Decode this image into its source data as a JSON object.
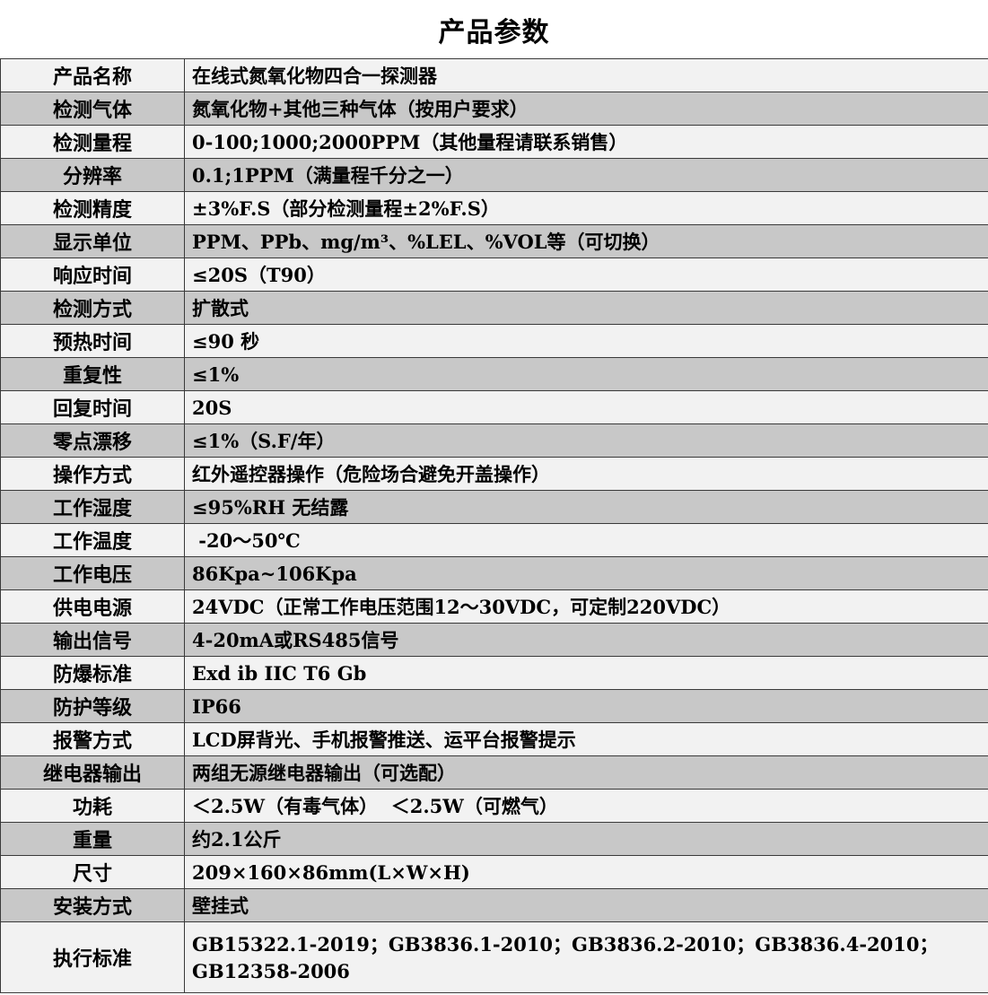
{
  "title": "产品参数",
  "rows": [
    {
      "label": "产品名称",
      "value": "在线式氮氧化物四合一探测器"
    },
    {
      "label": "检测气体",
      "value": "氮氧化物+其他三种气体（按用户要求）"
    },
    {
      "label": "检测量程",
      "value": "0-100;1000;2000PPM（其他量程请联系销售）"
    },
    {
      "label": "分辨率",
      "value": "0.1;1PPM（满量程千分之一）"
    },
    {
      "label": "检测精度",
      "value": "±3%F.S（部分检测量程±2%F.S）"
    },
    {
      "label": "显示单位",
      "value": "PPM、PPb、mg/m³、%LEL、%VOL等（可切换）"
    },
    {
      "label": "响应时间",
      "value": "≤20S（T90）"
    },
    {
      "label": "检测方式",
      "value": "扩散式"
    },
    {
      "label": "预热时间",
      "value": "≤90 秒"
    },
    {
      "label": "重复性",
      "value": "≤1%"
    },
    {
      "label": "回复时间",
      "value": "20S"
    },
    {
      "label": "零点漂移",
      "value": "≤1%（S.F/年）"
    },
    {
      "label": "操作方式",
      "value": "红外遥控器操作（危险场合避免开盖操作）"
    },
    {
      "label": "工作湿度",
      "value": "≤95%RH 无结露"
    },
    {
      "label": "工作温度",
      "value": " -20～50℃"
    },
    {
      "label": "工作电压",
      "value": "86Kpa~106Kpa"
    },
    {
      "label": "供电电源",
      "value": "24VDC（正常工作电压范围12～30VDC，可定制220VDC）"
    },
    {
      "label": "输出信号",
      "value": "4-20mA或RS485信号"
    },
    {
      "label": "防爆标准",
      "value": "Exd ib IIC T6 Gb"
    },
    {
      "label": "防护等级",
      "value": "IP66"
    },
    {
      "label": "报警方式",
      "value": "LCD屏背光、手机报警推送、运平台报警提示"
    },
    {
      "label": "继电器输出",
      "value": "两组无源继电器输出（可选配）"
    },
    {
      "label": "功耗",
      "value": "＜2.5W（有毒气体）  ＜2.5W（可燃气）"
    },
    {
      "label": "重量",
      "value": "约2.1公斤"
    },
    {
      "label": "尺寸",
      "value": "209×160×86mm(L×W×H)"
    },
    {
      "label": "安装方式",
      "value": "壁挂式"
    },
    {
      "label": "执行标准",
      "value": "GB15322.1-2019；GB3836.1-2010；GB3836.2-2010；GB3836.4-2010；GB12358-2006"
    }
  ]
}
